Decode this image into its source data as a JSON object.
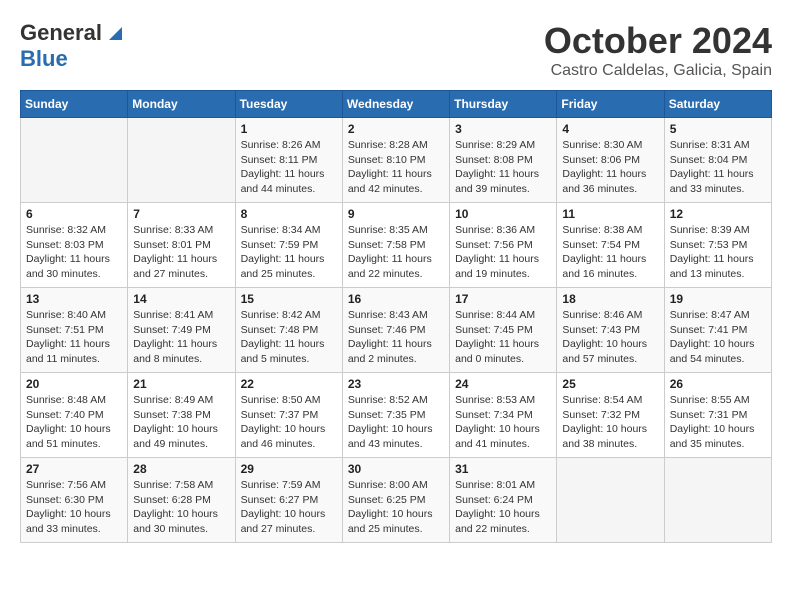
{
  "header": {
    "logo_general": "General",
    "logo_blue": "Blue",
    "month": "October 2024",
    "location": "Castro Caldelas, Galicia, Spain"
  },
  "days_of_week": [
    "Sunday",
    "Monday",
    "Tuesday",
    "Wednesday",
    "Thursday",
    "Friday",
    "Saturday"
  ],
  "weeks": [
    [
      {
        "day": "",
        "sunrise": "",
        "sunset": "",
        "daylight": ""
      },
      {
        "day": "",
        "sunrise": "",
        "sunset": "",
        "daylight": ""
      },
      {
        "day": "1",
        "sunrise": "Sunrise: 8:26 AM",
        "sunset": "Sunset: 8:11 PM",
        "daylight": "Daylight: 11 hours and 44 minutes."
      },
      {
        "day": "2",
        "sunrise": "Sunrise: 8:28 AM",
        "sunset": "Sunset: 8:10 PM",
        "daylight": "Daylight: 11 hours and 42 minutes."
      },
      {
        "day": "3",
        "sunrise": "Sunrise: 8:29 AM",
        "sunset": "Sunset: 8:08 PM",
        "daylight": "Daylight: 11 hours and 39 minutes."
      },
      {
        "day": "4",
        "sunrise": "Sunrise: 8:30 AM",
        "sunset": "Sunset: 8:06 PM",
        "daylight": "Daylight: 11 hours and 36 minutes."
      },
      {
        "day": "5",
        "sunrise": "Sunrise: 8:31 AM",
        "sunset": "Sunset: 8:04 PM",
        "daylight": "Daylight: 11 hours and 33 minutes."
      }
    ],
    [
      {
        "day": "6",
        "sunrise": "Sunrise: 8:32 AM",
        "sunset": "Sunset: 8:03 PM",
        "daylight": "Daylight: 11 hours and 30 minutes."
      },
      {
        "day": "7",
        "sunrise": "Sunrise: 8:33 AM",
        "sunset": "Sunset: 8:01 PM",
        "daylight": "Daylight: 11 hours and 27 minutes."
      },
      {
        "day": "8",
        "sunrise": "Sunrise: 8:34 AM",
        "sunset": "Sunset: 7:59 PM",
        "daylight": "Daylight: 11 hours and 25 minutes."
      },
      {
        "day": "9",
        "sunrise": "Sunrise: 8:35 AM",
        "sunset": "Sunset: 7:58 PM",
        "daylight": "Daylight: 11 hours and 22 minutes."
      },
      {
        "day": "10",
        "sunrise": "Sunrise: 8:36 AM",
        "sunset": "Sunset: 7:56 PM",
        "daylight": "Daylight: 11 hours and 19 minutes."
      },
      {
        "day": "11",
        "sunrise": "Sunrise: 8:38 AM",
        "sunset": "Sunset: 7:54 PM",
        "daylight": "Daylight: 11 hours and 16 minutes."
      },
      {
        "day": "12",
        "sunrise": "Sunrise: 8:39 AM",
        "sunset": "Sunset: 7:53 PM",
        "daylight": "Daylight: 11 hours and 13 minutes."
      }
    ],
    [
      {
        "day": "13",
        "sunrise": "Sunrise: 8:40 AM",
        "sunset": "Sunset: 7:51 PM",
        "daylight": "Daylight: 11 hours and 11 minutes."
      },
      {
        "day": "14",
        "sunrise": "Sunrise: 8:41 AM",
        "sunset": "Sunset: 7:49 PM",
        "daylight": "Daylight: 11 hours and 8 minutes."
      },
      {
        "day": "15",
        "sunrise": "Sunrise: 8:42 AM",
        "sunset": "Sunset: 7:48 PM",
        "daylight": "Daylight: 11 hours and 5 minutes."
      },
      {
        "day": "16",
        "sunrise": "Sunrise: 8:43 AM",
        "sunset": "Sunset: 7:46 PM",
        "daylight": "Daylight: 11 hours and 2 minutes."
      },
      {
        "day": "17",
        "sunrise": "Sunrise: 8:44 AM",
        "sunset": "Sunset: 7:45 PM",
        "daylight": "Daylight: 11 hours and 0 minutes."
      },
      {
        "day": "18",
        "sunrise": "Sunrise: 8:46 AM",
        "sunset": "Sunset: 7:43 PM",
        "daylight": "Daylight: 10 hours and 57 minutes."
      },
      {
        "day": "19",
        "sunrise": "Sunrise: 8:47 AM",
        "sunset": "Sunset: 7:41 PM",
        "daylight": "Daylight: 10 hours and 54 minutes."
      }
    ],
    [
      {
        "day": "20",
        "sunrise": "Sunrise: 8:48 AM",
        "sunset": "Sunset: 7:40 PM",
        "daylight": "Daylight: 10 hours and 51 minutes."
      },
      {
        "day": "21",
        "sunrise": "Sunrise: 8:49 AM",
        "sunset": "Sunset: 7:38 PM",
        "daylight": "Daylight: 10 hours and 49 minutes."
      },
      {
        "day": "22",
        "sunrise": "Sunrise: 8:50 AM",
        "sunset": "Sunset: 7:37 PM",
        "daylight": "Daylight: 10 hours and 46 minutes."
      },
      {
        "day": "23",
        "sunrise": "Sunrise: 8:52 AM",
        "sunset": "Sunset: 7:35 PM",
        "daylight": "Daylight: 10 hours and 43 minutes."
      },
      {
        "day": "24",
        "sunrise": "Sunrise: 8:53 AM",
        "sunset": "Sunset: 7:34 PM",
        "daylight": "Daylight: 10 hours and 41 minutes."
      },
      {
        "day": "25",
        "sunrise": "Sunrise: 8:54 AM",
        "sunset": "Sunset: 7:32 PM",
        "daylight": "Daylight: 10 hours and 38 minutes."
      },
      {
        "day": "26",
        "sunrise": "Sunrise: 8:55 AM",
        "sunset": "Sunset: 7:31 PM",
        "daylight": "Daylight: 10 hours and 35 minutes."
      }
    ],
    [
      {
        "day": "27",
        "sunrise": "Sunrise: 7:56 AM",
        "sunset": "Sunset: 6:30 PM",
        "daylight": "Daylight: 10 hours and 33 minutes."
      },
      {
        "day": "28",
        "sunrise": "Sunrise: 7:58 AM",
        "sunset": "Sunset: 6:28 PM",
        "daylight": "Daylight: 10 hours and 30 minutes."
      },
      {
        "day": "29",
        "sunrise": "Sunrise: 7:59 AM",
        "sunset": "Sunset: 6:27 PM",
        "daylight": "Daylight: 10 hours and 27 minutes."
      },
      {
        "day": "30",
        "sunrise": "Sunrise: 8:00 AM",
        "sunset": "Sunset: 6:25 PM",
        "daylight": "Daylight: 10 hours and 25 minutes."
      },
      {
        "day": "31",
        "sunrise": "Sunrise: 8:01 AM",
        "sunset": "Sunset: 6:24 PM",
        "daylight": "Daylight: 10 hours and 22 minutes."
      },
      {
        "day": "",
        "sunrise": "",
        "sunset": "",
        "daylight": ""
      },
      {
        "day": "",
        "sunrise": "",
        "sunset": "",
        "daylight": ""
      }
    ]
  ]
}
